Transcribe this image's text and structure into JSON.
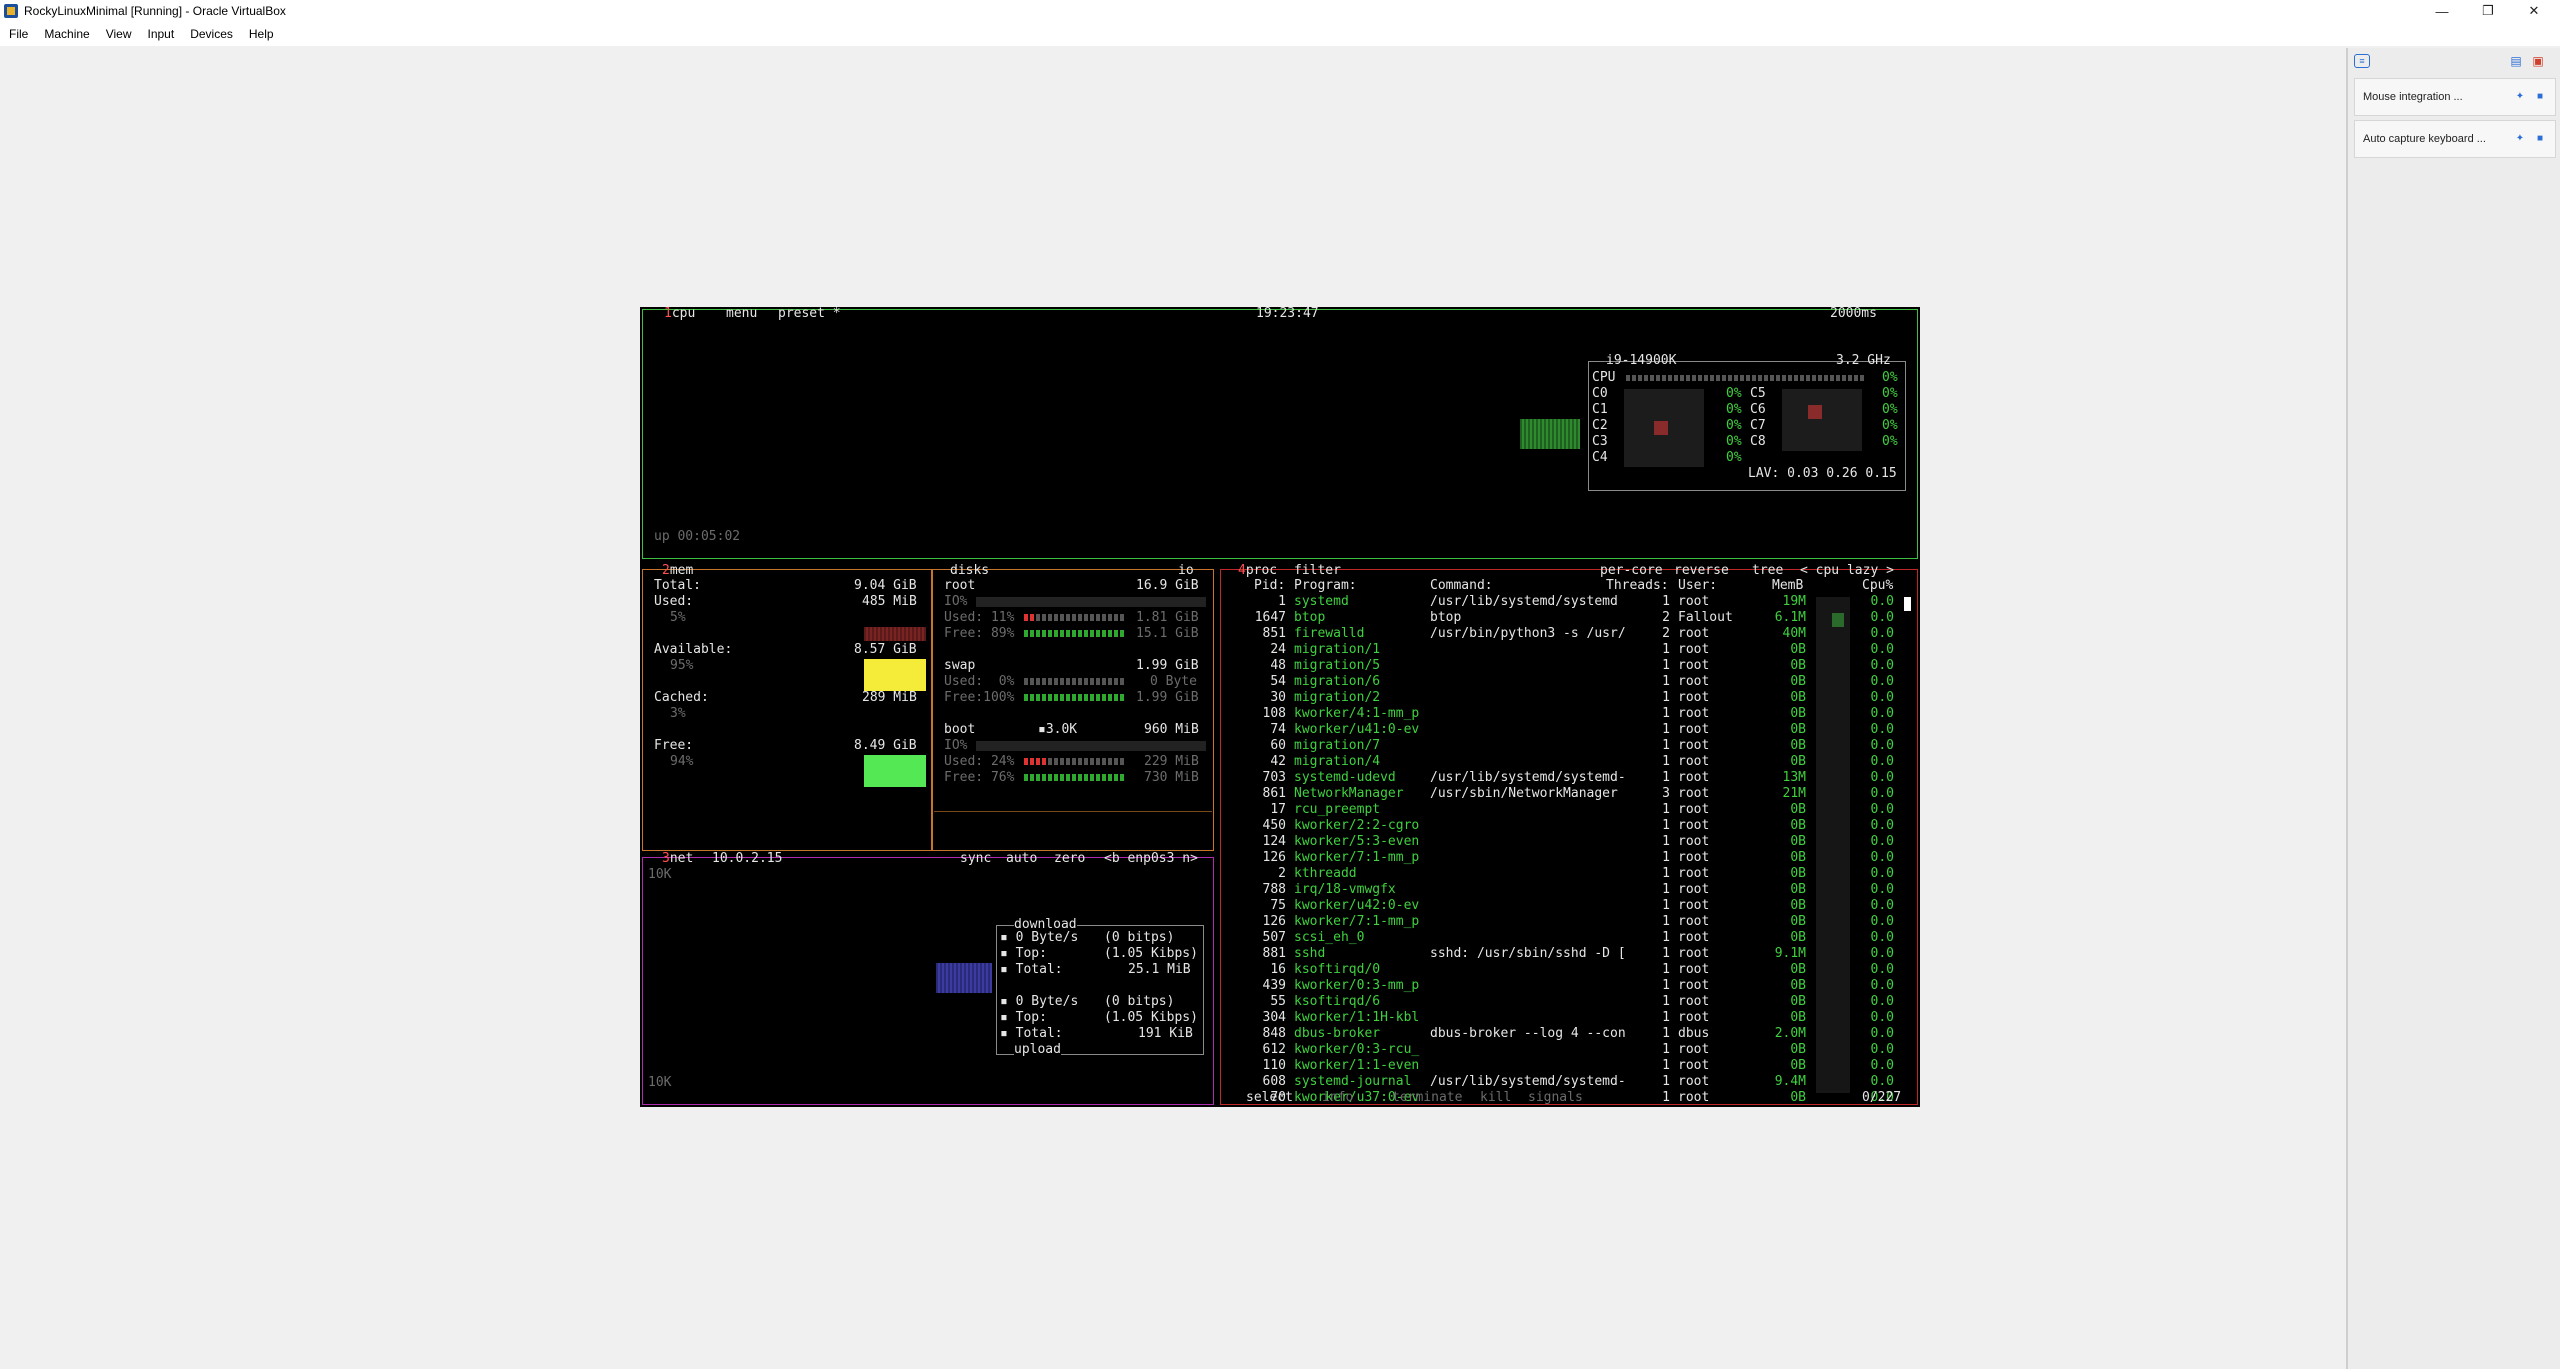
{
  "window": {
    "title": "RockyLinuxMinimal [Running] - Oracle VirtualBox",
    "minimize_icon": "minimize-icon",
    "maximize_icon": "restore-icon",
    "close_icon": "close-icon"
  },
  "menu": [
    "File",
    "Machine",
    "View",
    "Input",
    "Devices",
    "Help"
  ],
  "notifications": [
    {
      "text": "Mouse integration ..."
    },
    {
      "text": "Auto capture keyboard ..."
    }
  ],
  "btop": {
    "cpu": {
      "tab": "cpu",
      "menu": "menu",
      "preset": "preset *",
      "clock": "19:23:47",
      "interval": "2000ms",
      "model": "i9-14900K",
      "freq": "3.2 GHz",
      "cores": [
        {
          "label": "CPU",
          "pct": "0%"
        },
        {
          "label": "C0",
          "pct": "0%"
        },
        {
          "label": "C1",
          "pct": "0%"
        },
        {
          "label": "C2",
          "pct": "0%"
        },
        {
          "label": "C3",
          "pct": "0%"
        },
        {
          "label": "C4",
          "pct": "0%"
        },
        {
          "label": "C5",
          "pct": "0%"
        },
        {
          "label": "C6",
          "pct": "0%"
        },
        {
          "label": "C7",
          "pct": "0%"
        },
        {
          "label": "C8",
          "pct": "0%"
        }
      ],
      "lav": "LAV: 0.03 0.26 0.15",
      "uptime": "up 00:05:02"
    },
    "mem": {
      "tab": "mem",
      "rows": [
        {
          "label": "Total:",
          "value": "9.04 GiB",
          "pct": ""
        },
        {
          "label": "Used:",
          "value": "485 MiB",
          "pct": "5%"
        },
        {
          "label": "Available:",
          "value": "8.57 GiB",
          "pct": "95%"
        },
        {
          "label": "Cached:",
          "value": "289 MiB",
          "pct": "3%"
        },
        {
          "label": "Free:",
          "value": "8.49 GiB",
          "pct": "94%"
        }
      ]
    },
    "disks": {
      "tab": "disks",
      "io": "io",
      "root": {
        "name": "root",
        "size": "16.9 GiB",
        "io": "IO%",
        "used_label": "Used: 11%",
        "used": "1.81 GiB",
        "free_label": "Free: 89%",
        "free": "15.1 GiB"
      },
      "swap": {
        "name": "swap",
        "size": "1.99 GiB",
        "used_label": "Used:  0%",
        "used": "0 Byte",
        "free_label": "Free:100%",
        "free": "1.99 GiB"
      },
      "boot": {
        "name": "boot",
        "io_rate": "▪3.0K",
        "size": "960 MiB",
        "io": "IO%",
        "used_label": "Used: 24%",
        "used": "229 MiB",
        "free_label": "Free: 76%",
        "free": "730 MiB"
      }
    },
    "net": {
      "tab": "net",
      "ip": "10.0.2.15",
      "sync": "sync",
      "auto": "auto",
      "zero": "zero",
      "iface": "<b enp0s3 n>",
      "scale_top": "10K",
      "scale_bottom": "10K",
      "download_label": "download",
      "download": [
        {
          "k": "▪ 0 Byte/s",
          "v": "(0 bitps)"
        },
        {
          "k": "▪ Top:",
          "v": "(1.05 Kibps)"
        },
        {
          "k": "▪ Total:",
          "v": "25.1 MiB"
        }
      ],
      "upload": [
        {
          "k": "▪ 0 Byte/s",
          "v": "(0 bitps)"
        },
        {
          "k": "▪ Top:",
          "v": "(1.05 Kibps)"
        },
        {
          "k": "▪ Total:",
          "v": "191 KiB"
        }
      ],
      "upload_label": "upload"
    },
    "proc": {
      "tab": "proc",
      "filter": "filter",
      "per_core": "per-core",
      "reverse": "reverse",
      "tree": "tree",
      "sort": "< cpu lazy >",
      "headers": {
        "pid": "Pid:",
        "program": "Program:",
        "command": "Command:",
        "threads": "Threads:",
        "user": "User:",
        "mem": "MemB",
        "cpu": "Cpu%"
      },
      "rows": [
        {
          "pid": "1",
          "program": "systemd",
          "command": "/usr/lib/systemd/systemd",
          "threads": "1",
          "user": "root",
          "mem": "19M",
          "cpu": "0.0"
        },
        {
          "pid": "1647",
          "program": "btop",
          "command": "btop",
          "threads": "2",
          "user": "Fallout",
          "mem": "6.1M",
          "cpu": "0.0"
        },
        {
          "pid": "851",
          "program": "firewalld",
          "command": "/usr/bin/python3 -s /usr/",
          "threads": "2",
          "user": "root",
          "mem": "40M",
          "cpu": "0.0"
        },
        {
          "pid": "24",
          "program": "migration/1",
          "command": "",
          "threads": "1",
          "user": "root",
          "mem": "0B",
          "cpu": "0.0"
        },
        {
          "pid": "48",
          "program": "migration/5",
          "command": "",
          "threads": "1",
          "user": "root",
          "mem": "0B",
          "cpu": "0.0"
        },
        {
          "pid": "54",
          "program": "migration/6",
          "command": "",
          "threads": "1",
          "user": "root",
          "mem": "0B",
          "cpu": "0.0"
        },
        {
          "pid": "30",
          "program": "migration/2",
          "command": "",
          "threads": "1",
          "user": "root",
          "mem": "0B",
          "cpu": "0.0"
        },
        {
          "pid": "108",
          "program": "kworker/4:1-mm_p",
          "command": "",
          "threads": "1",
          "user": "root",
          "mem": "0B",
          "cpu": "0.0"
        },
        {
          "pid": "74",
          "program": "kworker/u41:0-ev",
          "command": "",
          "threads": "1",
          "user": "root",
          "mem": "0B",
          "cpu": "0.0"
        },
        {
          "pid": "60",
          "program": "migration/7",
          "command": "",
          "threads": "1",
          "user": "root",
          "mem": "0B",
          "cpu": "0.0"
        },
        {
          "pid": "42",
          "program": "migration/4",
          "command": "",
          "threads": "1",
          "user": "root",
          "mem": "0B",
          "cpu": "0.0"
        },
        {
          "pid": "703",
          "program": "systemd-udevd",
          "command": "/usr/lib/systemd/systemd-",
          "threads": "1",
          "user": "root",
          "mem": "13M",
          "cpu": "0.0"
        },
        {
          "pid": "861",
          "program": "NetworkManager",
          "command": "/usr/sbin/NetworkManager",
          "threads": "3",
          "user": "root",
          "mem": "21M",
          "cpu": "0.0"
        },
        {
          "pid": "17",
          "program": "rcu_preempt",
          "command": "",
          "threads": "1",
          "user": "root",
          "mem": "0B",
          "cpu": "0.0"
        },
        {
          "pid": "450",
          "program": "kworker/2:2-cgro",
          "command": "",
          "threads": "1",
          "user": "root",
          "mem": "0B",
          "cpu": "0.0"
        },
        {
          "pid": "124",
          "program": "kworker/5:3-even",
          "command": "",
          "threads": "1",
          "user": "root",
          "mem": "0B",
          "cpu": "0.0"
        },
        {
          "pid": "126",
          "program": "kworker/7:1-mm_p",
          "command": "",
          "threads": "1",
          "user": "root",
          "mem": "0B",
          "cpu": "0.0"
        },
        {
          "pid": "2",
          "program": "kthreadd",
          "command": "",
          "threads": "1",
          "user": "root",
          "mem": "0B",
          "cpu": "0.0"
        },
        {
          "pid": "788",
          "program": "irq/18-vmwgfx",
          "command": "",
          "threads": "1",
          "user": "root",
          "mem": "0B",
          "cpu": "0.0"
        },
        {
          "pid": "75",
          "program": "kworker/u42:0-ev",
          "command": "",
          "threads": "1",
          "user": "root",
          "mem": "0B",
          "cpu": "0.0"
        },
        {
          "pid": "126",
          "program": "kworker/7:1-mm_p",
          "command": "",
          "threads": "1",
          "user": "root",
          "mem": "0B",
          "cpu": "0.0"
        },
        {
          "pid": "507",
          "program": "scsi_eh_0",
          "command": "",
          "threads": "1",
          "user": "root",
          "mem": "0B",
          "cpu": "0.0"
        },
        {
          "pid": "881",
          "program": "sshd",
          "command": "sshd: /usr/sbin/sshd -D [",
          "threads": "1",
          "user": "root",
          "mem": "9.1M",
          "cpu": "0.0"
        },
        {
          "pid": "16",
          "program": "ksoftirqd/0",
          "command": "",
          "threads": "1",
          "user": "root",
          "mem": "0B",
          "cpu": "0.0"
        },
        {
          "pid": "439",
          "program": "kworker/0:3-mm_p",
          "command": "",
          "threads": "1",
          "user": "root",
          "mem": "0B",
          "cpu": "0.0"
        },
        {
          "pid": "55",
          "program": "ksoftirqd/6",
          "command": "",
          "threads": "1",
          "user": "root",
          "mem": "0B",
          "cpu": "0.0"
        },
        {
          "pid": "304",
          "program": "kworker/1:1H-kbl",
          "command": "",
          "threads": "1",
          "user": "root",
          "mem": "0B",
          "cpu": "0.0"
        },
        {
          "pid": "848",
          "program": "dbus-broker",
          "command": "dbus-broker --log 4 --con",
          "threads": "1",
          "user": "dbus",
          "mem": "2.0M",
          "cpu": "0.0"
        },
        {
          "pid": "612",
          "program": "kworker/0:3-rcu_",
          "command": "",
          "threads": "1",
          "user": "root",
          "mem": "0B",
          "cpu": "0.0"
        },
        {
          "pid": "110",
          "program": "kworker/1:1-even",
          "command": "",
          "threads": "1",
          "user": "root",
          "mem": "0B",
          "cpu": "0.0"
        },
        {
          "pid": "608",
          "program": "systemd-journal",
          "command": "/usr/lib/systemd/systemd-",
          "threads": "1",
          "user": "root",
          "mem": "9.4M",
          "cpu": "0.0"
        },
        {
          "pid": "70",
          "program": "kworker/u37:0-ev",
          "command": "",
          "threads": "1",
          "user": "root",
          "mem": "0B",
          "cpu": "0.0"
        }
      ],
      "footer_select": "select",
      "footer_info": "info",
      "footer_terminate": "terminate",
      "footer_kill": "kill",
      "footer_signals": "signals",
      "count": "0/227"
    }
  },
  "colors": {
    "cpu_box": "#3fbf3f",
    "mem_box": "#c8742a",
    "net_box": "#b02ab0",
    "proc_box": "#c02828",
    "green": "#3fd13f"
  }
}
